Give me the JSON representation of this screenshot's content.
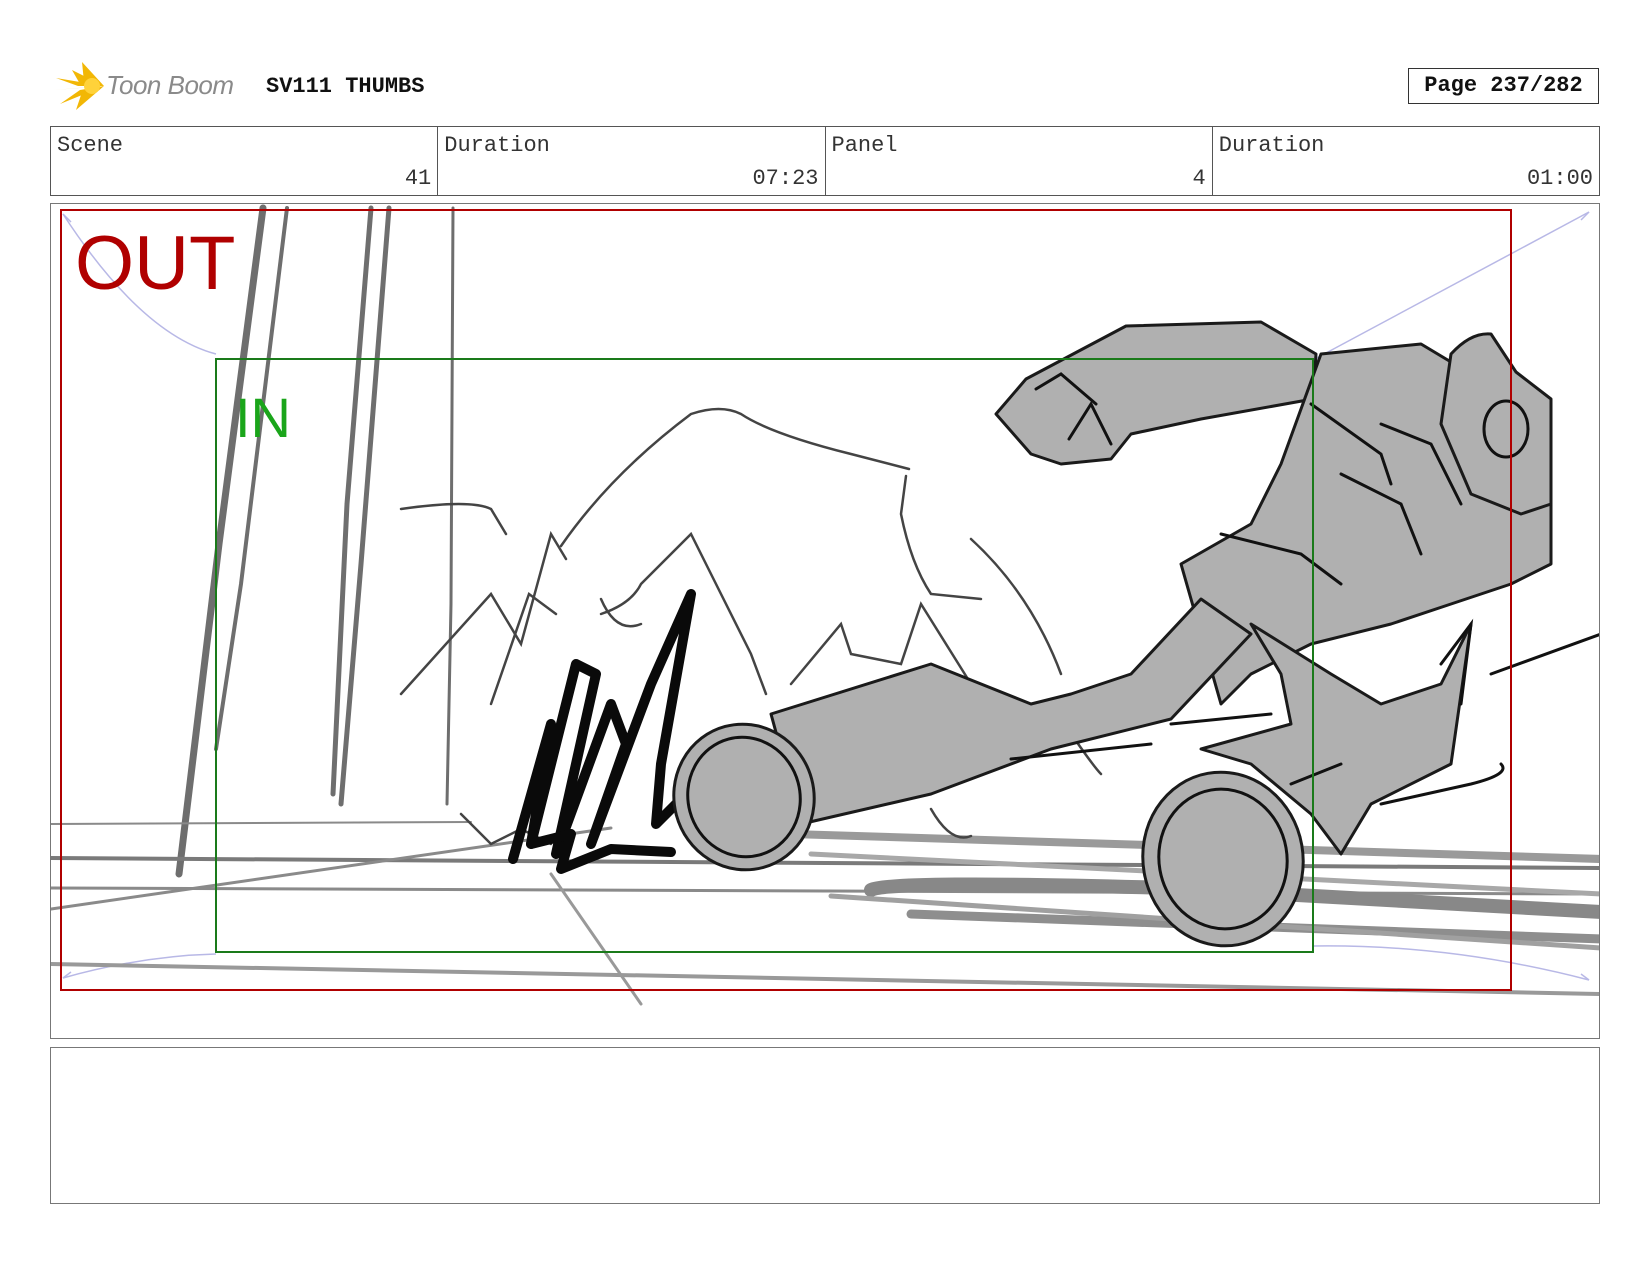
{
  "header": {
    "logo_text": "Toon Boom",
    "project_title": "SV111 THUMBS",
    "page_label": "Page 237/282"
  },
  "info_bar": [
    {
      "label": "Scene",
      "value": "41"
    },
    {
      "label": "Duration",
      "value": "07:23"
    },
    {
      "label": "Panel",
      "value": "4"
    },
    {
      "label": "Duration",
      "value": "01:00"
    }
  ],
  "panel": {
    "out_label": "OUT",
    "in_label": "IN",
    "colors": {
      "out_frame": "#b00000",
      "in_frame": "#1a7a1a",
      "camera_path": "#b8b8e6",
      "sketch_fill": "#b3b3b3",
      "sketch_line": "#1a1a1a"
    }
  },
  "notes": {
    "text": ""
  },
  "icons": {
    "logo": "toon-boom-starburst-icon"
  }
}
